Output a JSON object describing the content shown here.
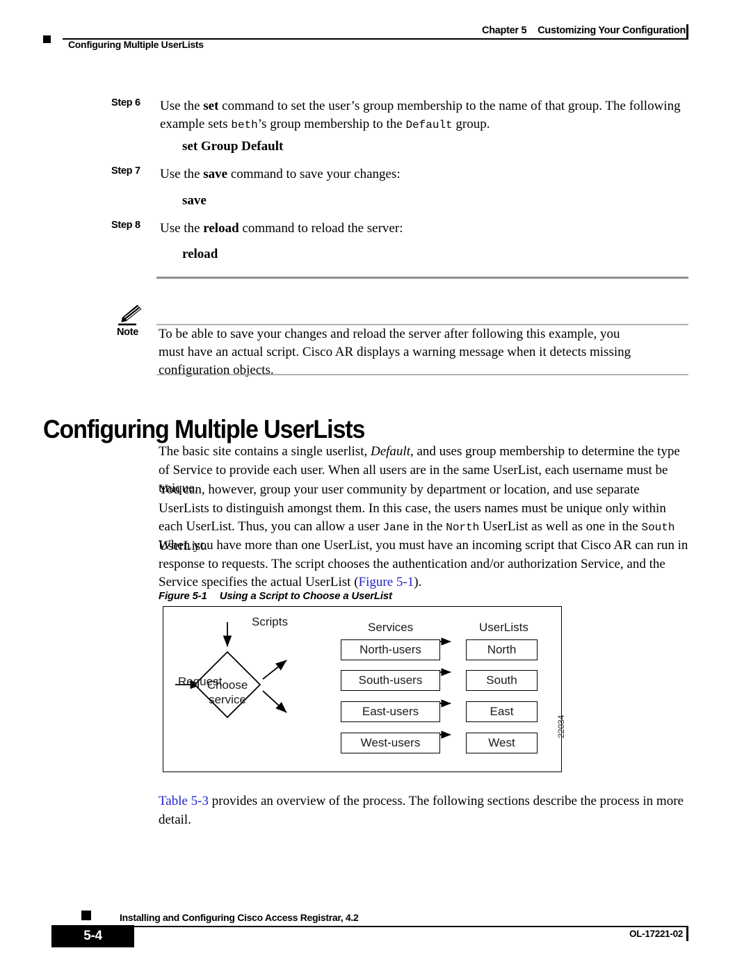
{
  "header": {
    "chapter": "Chapter 5",
    "chapter_title": "Customizing Your Configuration",
    "running_title": "Configuring Multiple UserLists"
  },
  "steps": [
    {
      "label": "Step 6",
      "text_parts": [
        {
          "t": "Use the ",
          "s": "normal"
        },
        {
          "t": "set",
          "s": "bold"
        },
        {
          "t": " command to set the user’s group membership to the name of that group. The following example sets ",
          "s": "normal"
        },
        {
          "t": "beth",
          "s": "mono"
        },
        {
          "t": "’s group membership to the ",
          "s": "normal"
        },
        {
          "t": "Default",
          "s": "mono"
        },
        {
          "t": " group.",
          "s": "normal"
        }
      ],
      "command": "set Group Default"
    },
    {
      "label": "Step 7",
      "text_parts": [
        {
          "t": "Use the ",
          "s": "normal"
        },
        {
          "t": "save",
          "s": "bold"
        },
        {
          "t": " command to save your changes:",
          "s": "normal"
        }
      ],
      "command": "save"
    },
    {
      "label": "Step 8",
      "text_parts": [
        {
          "t": "Use the ",
          "s": "normal"
        },
        {
          "t": "reload",
          "s": "bold"
        },
        {
          "t": " command to reload the server:",
          "s": "normal"
        }
      ],
      "command": "reload"
    }
  ],
  "note": {
    "label": "Note",
    "icon": "pencil-icon",
    "text": "To be able to save your changes and reload the server after following this example, you must have an actual script. Cisco AR displays a warning message when it detects missing configuration objects."
  },
  "section": {
    "heading": "Configuring Multiple UserLists",
    "paragraphs": [
      {
        "id": "para-1",
        "parts": [
          {
            "t": "The basic site contains a single userlist, ",
            "s": "normal"
          },
          {
            "t": "Default",
            "s": "italic"
          },
          {
            "t": ", and uses group membership to determine the type of Service to provide each user. When all users are in the same UserList, each username must be unique.",
            "s": "normal"
          }
        ]
      },
      {
        "id": "para-2",
        "parts": [
          {
            "t": "You can, however, group your user community by department or location, and use separate UserLists to distinguish amongst them. In this case, the users names must be unique only within each UserList. Thus, you can allow a user ",
            "s": "normal"
          },
          {
            "t": "Jane",
            "s": "mono"
          },
          {
            "t": " in the ",
            "s": "normal"
          },
          {
            "t": "North",
            "s": "mono"
          },
          {
            "t": " UserList as well as one in the ",
            "s": "normal"
          },
          {
            "t": "South",
            "s": "mono"
          },
          {
            "t": " UserList.",
            "s": "normal"
          }
        ]
      },
      {
        "id": "para-3",
        "parts": [
          {
            "t": "When you have more than one UserList, you must have an incoming script that Cisco AR can run in response to requests. The script chooses the authentication and/or authorization Service, and the Service specifies the actual UserList (",
            "s": "normal"
          },
          {
            "t": "Figure 5-1",
            "s": "xref"
          },
          {
            "t": ").",
            "s": "normal"
          }
        ]
      }
    ],
    "after_figure": {
      "id": "para-4",
      "parts": [
        {
          "t": "Table 5-3",
          "s": "xref"
        },
        {
          "t": " provides an overview of the process. The following sections describe the process in more detail.",
          "s": "normal"
        }
      ]
    }
  },
  "figure": {
    "number": "Figure 5-1",
    "title": "Using a Script to Choose a UserList",
    "art_id": "22034",
    "diagram": {
      "request_label": "Request",
      "scripts_label": "Scripts",
      "decision_line1": "Choose",
      "decision_line2": "service",
      "services_header": "Services",
      "userlists_header": "UserLists",
      "rows": [
        {
          "service": "North-users",
          "userlist": "North"
        },
        {
          "service": "South-users",
          "userlist": "South"
        },
        {
          "service": "East-users",
          "userlist": "East"
        },
        {
          "service": "West-users",
          "userlist": "West"
        }
      ]
    }
  },
  "footer": {
    "page_number": "5-4",
    "book_title": "Installing and Configuring Cisco Access Registrar, 4.2",
    "doc_id": "OL-17221-02"
  }
}
